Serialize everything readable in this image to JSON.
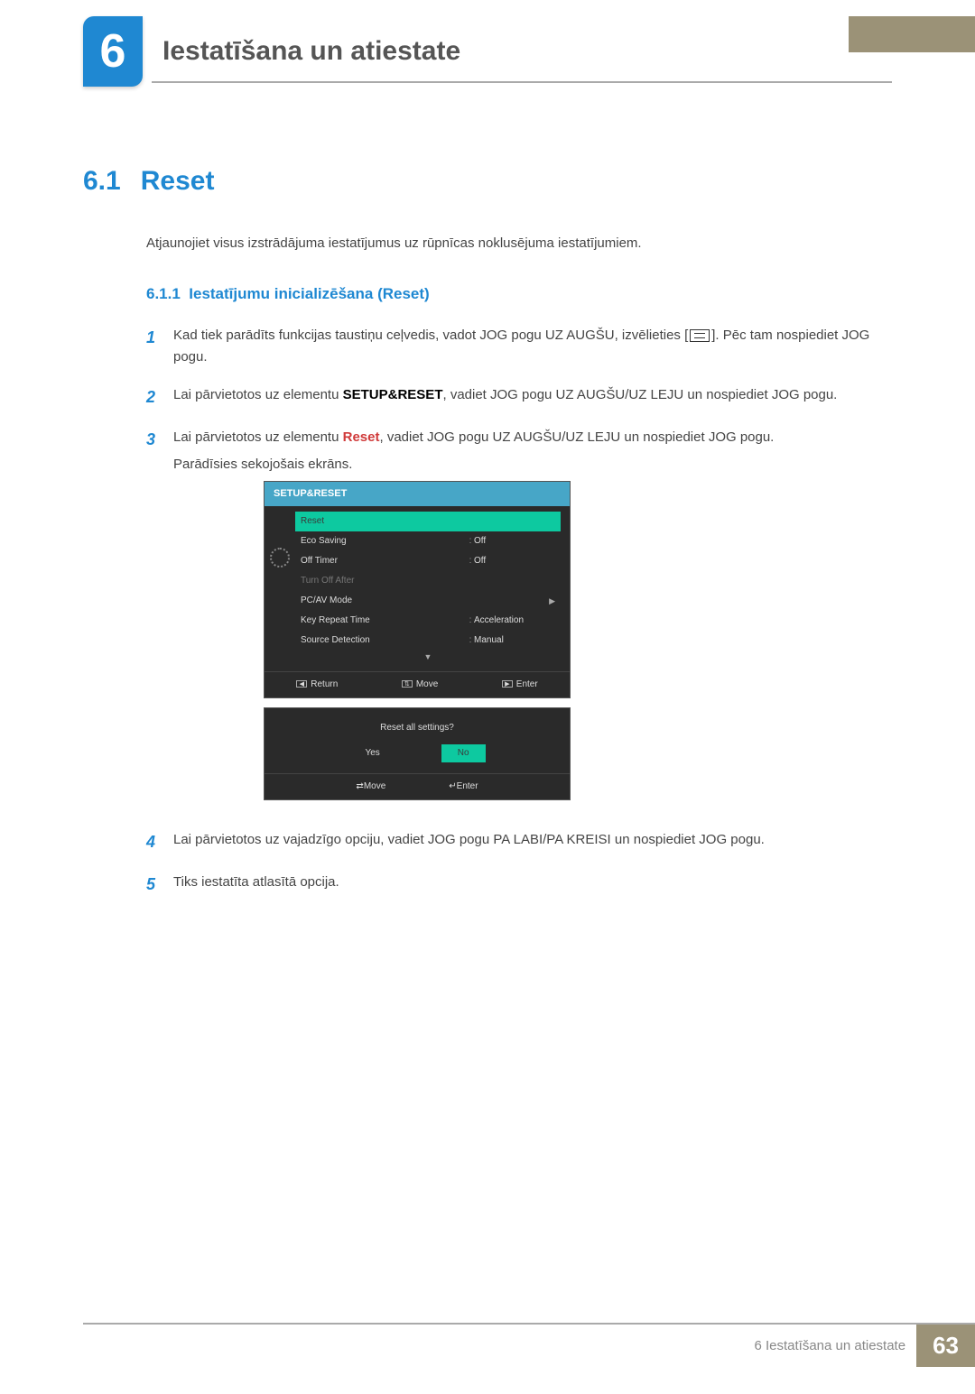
{
  "chapter": {
    "number": "6",
    "title": "Iestatīšana un atiestate"
  },
  "section": {
    "number": "6.1",
    "title": "Reset",
    "intro": "Atjaunojiet visus izstrādājuma iestatījumus uz rūpnīcas noklusējuma iestatījumiem."
  },
  "subsection": {
    "number": "6.1.1",
    "title": "Iestatījumu inicializēšana (Reset)"
  },
  "steps": {
    "s1a": "Kad tiek parādīts funkcijas taustiņu ceļvedis, vadot JOG pogu UZ AUGŠU, izvēlieties [",
    "s1b": "]. Pēc tam nospiediet JOG pogu.",
    "s2a": "Lai pārvietotos uz elementu ",
    "s2b": "SETUP&RESET",
    "s2c": ", vadiet JOG pogu UZ AUGŠU/UZ LEJU un nospiediet JOG pogu.",
    "s3a": "Lai pārvietotos uz elementu ",
    "s3b": "Reset",
    "s3c": ", vadiet JOG pogu UZ AUGŠU/UZ LEJU un nospiediet JOG pogu.",
    "s3d": "Parādīsies sekojošais ekrāns.",
    "s4": "Lai pārvietotos uz vajadzīgo opciju, vadiet JOG pogu PA LABI/PA KREISI un nospiediet JOG pogu.",
    "s5": "Tiks iestatīta atlasītā opcija."
  },
  "nums": {
    "n1": "1",
    "n2": "2",
    "n3": "3",
    "n4": "4",
    "n5": "5"
  },
  "osd": {
    "title": "SETUP&RESET",
    "rows": {
      "reset": "Reset",
      "eco": "Eco Saving",
      "eco_v": "Off",
      "off": "Off Timer",
      "off_v": "Off",
      "turnoff": "Turn Off After",
      "pcav": "PC/AV Mode",
      "key": "Key Repeat Time",
      "key_v": "Acceleration",
      "src": "Source Detection",
      "src_v": "Manual"
    },
    "footer": {
      "return": "Return",
      "move": "Move",
      "enter": "Enter"
    }
  },
  "osd2": {
    "question": "Reset all settings?",
    "yes": "Yes",
    "no": "No",
    "move": "Move",
    "enter": "Enter"
  },
  "footer": {
    "text": "6 Iestatīšana un atiestate",
    "page": "63"
  }
}
